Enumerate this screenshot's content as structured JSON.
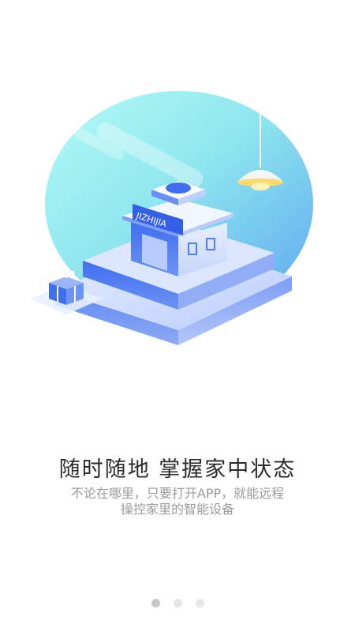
{
  "onboarding": {
    "illustration": {
      "sign_text": "JIZHIJIA",
      "icons": [
        "house-building-icon",
        "pendant-lamp-icon",
        "gift-box-icon"
      ]
    },
    "headline": "随时随地 掌握家中状态",
    "description_lines": [
      "不论在哪里，只要打开APP，就能远程",
      "操控家里的智能设备"
    ],
    "pager": {
      "total": 3,
      "active_index": 0
    },
    "colors": {
      "blue": "#4f7df2",
      "teal": "#9ef4ee",
      "headline": "#2b2b2b",
      "desc": "#9b9b9b",
      "dot_active": "#c7c7c7",
      "dot_inactive": "#e6e6e6"
    }
  }
}
